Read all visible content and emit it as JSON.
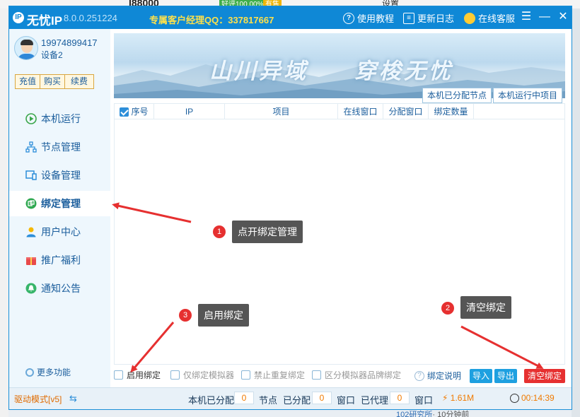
{
  "background": {
    "top_text": "I88000",
    "rating_badge": "好评100.00%",
    "quality_badge": "有售",
    "settings_text": "设置",
    "bottom_author": "102研究所",
    "bottom_time": "· 10分钟前"
  },
  "titlebar": {
    "app_name": "无忧IP",
    "version": "8.0.0.251224",
    "manager": "专属客户经理QQ：337817667",
    "tutorial": "使用教程",
    "changelog": "更新日志",
    "service": "在线客服"
  },
  "user": {
    "phone": "19974899417",
    "device": "设备2",
    "recharge": "充值",
    "buy": "购买",
    "renew": "续费"
  },
  "nav": [
    {
      "label": "本机运行",
      "icon": "play-icon"
    },
    {
      "label": "节点管理",
      "icon": "network-icon"
    },
    {
      "label": "设备管理",
      "icon": "device-icon"
    },
    {
      "label": "绑定管理",
      "icon": "bind-icon"
    },
    {
      "label": "用户中心",
      "icon": "user-icon"
    },
    {
      "label": "推广福利",
      "icon": "gift-icon"
    },
    {
      "label": "通知公告",
      "icon": "bell-icon"
    }
  ],
  "more_label": "更多功能",
  "banner": {
    "slogan_left": "山川异域",
    "slogan_right": "穿梭无忧"
  },
  "tabs": {
    "assigned_nodes": "本机已分配节点",
    "running_items": "本机运行中项目"
  },
  "table": {
    "headers": [
      "序号",
      "IP",
      "项目",
      "在线窗口",
      "分配窗口",
      "绑定数量"
    ]
  },
  "options": {
    "enable_bind": "启用绑定",
    "emulator_only": "仅绑定模拟器",
    "no_repeat": "禁止重复绑定",
    "brand_distinct": "区分模拟器品牌绑定",
    "help": "绑定说明",
    "import": "导入",
    "export": "导出",
    "clear": "清空绑定"
  },
  "status": {
    "mode": "驱动模式[v5]",
    "assigned_label": "本机已分配",
    "assigned_value": "0",
    "node_label": "节点",
    "allocated_label": "已分配",
    "allocated_value": "0",
    "window_label": "窗口",
    "proxied_label": "已代理",
    "proxied_value": "0",
    "window_label2": "窗口",
    "speed": "1.61M",
    "timer": "00:14:39"
  },
  "annotations": [
    {
      "num": "1",
      "text": "点开绑定管理"
    },
    {
      "num": "2",
      "text": "清空绑定"
    },
    {
      "num": "3",
      "text": "启用绑定"
    }
  ],
  "colors": {
    "title_bg": "#0f88d6",
    "accent": "#1a5d9c",
    "danger": "#e63030",
    "button": "#1ea0e0"
  }
}
